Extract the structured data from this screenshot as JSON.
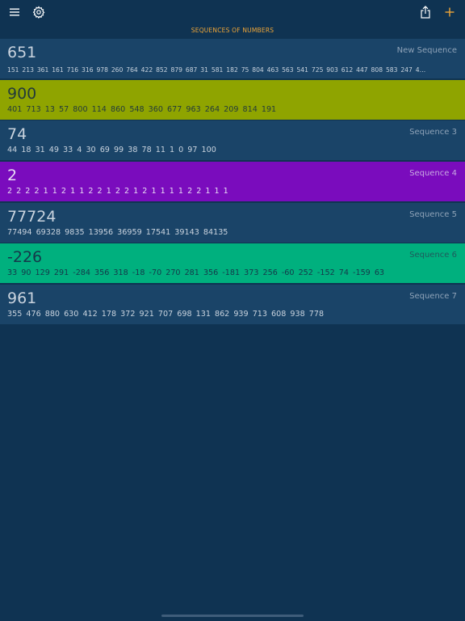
{
  "header": {
    "title": "SEQUENCES OF NUMBERS",
    "icons": {
      "menu": "hamburger-menu-icon",
      "settings": "gear-icon",
      "share": "share-icon",
      "add": "plus-icon"
    },
    "accent_color": "#f0a637"
  },
  "sequences": [
    {
      "value": "651",
      "name": "New Sequence",
      "numbers": "151 213 361 161 716 316 978 260 764 422 852 879 687 31 581 182 75 804 463 563 541 725 903 612 447 808 583 247 4…",
      "bg": "#1a4468",
      "fg": "#c9d3de",
      "name_fg": "#8fa3b8",
      "small": true
    },
    {
      "value": "900",
      "name": "",
      "numbers": "401 713 13 57 800 114 860 548 360 677 963 264 209 814 191",
      "bg": "#8fa400",
      "fg": "#233b3a",
      "name_fg": "#233b3a",
      "small": false
    },
    {
      "value": "74",
      "name": "Sequence 3",
      "numbers": "44 18 31 49 33 4 30 69 99 38 78 11 1 0 97 100",
      "bg": "#1a4468",
      "fg": "#c9d3de",
      "name_fg": "#8fa3b8",
      "small": false
    },
    {
      "value": "2",
      "name": "Sequence 4",
      "numbers": "2 2 2 2 1 1 2 1 1 2 2 1 2 2 1 2 1 1 1 1 2 2 1 1 1",
      "bg": "#7a0cbd",
      "fg": "#e8dcf4",
      "name_fg": "#c8a9e2",
      "small": false
    },
    {
      "value": "77724",
      "name": "Sequence 5",
      "numbers": "77494 69328 9835 13956 36959 17541 39143 84135",
      "bg": "#1a4468",
      "fg": "#c9d3de",
      "name_fg": "#8fa3b8",
      "small": false
    },
    {
      "value": "-226",
      "name": "Sequence 6",
      "numbers": "33 90 129 291 -284 356 318 -18 -70 270 281 356 -181 373 256 -60 252 -152 74 -159 63",
      "bg": "#00b07e",
      "fg": "#15384a",
      "name_fg": "#1f5a5c",
      "small": false
    },
    {
      "value": "961",
      "name": "Sequence 7",
      "numbers": "355 476 880 630 412 178 372 921 707 698 131 862 939 713 608 938 778",
      "bg": "#1a4468",
      "fg": "#c9d3de",
      "name_fg": "#8fa3b8",
      "small": false
    }
  ]
}
